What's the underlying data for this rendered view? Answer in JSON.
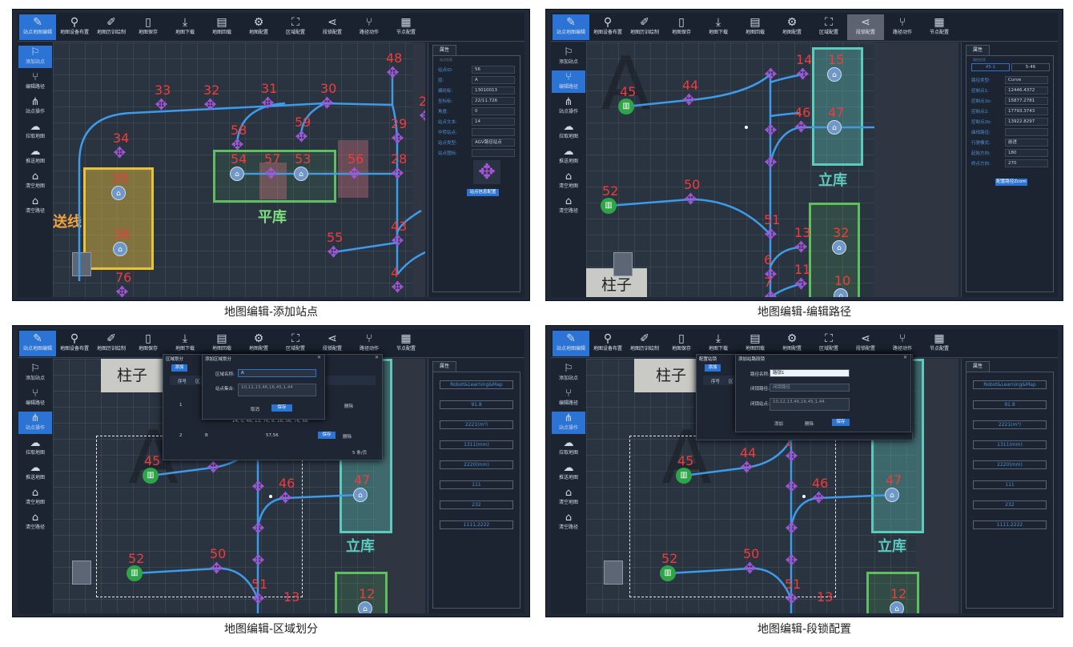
{
  "captions": [
    "地图编辑-添加站点",
    "地图编辑-编辑路径",
    "地图编辑-区域划分",
    "地图编辑-段锁配置"
  ],
  "toolbar": [
    {
      "label": "站点地图编辑",
      "icon": "✎"
    },
    {
      "label": "地图设备布置",
      "icon": "⚲"
    },
    {
      "label": "地图历训绘制",
      "icon": "✐"
    },
    {
      "label": "地图保存",
      "icon": "▯"
    },
    {
      "label": "地图下载",
      "icon": "⤓"
    },
    {
      "label": "地图回载",
      "icon": "▤"
    },
    {
      "label": "地图配置",
      "icon": "⚙"
    },
    {
      "label": "区域配置",
      "icon": "⛶"
    },
    {
      "label": "段锁配置",
      "icon": "⋖"
    },
    {
      "label": "路径动作",
      "icon": "⑂"
    },
    {
      "label": "节点配置",
      "icon": "▦"
    }
  ],
  "sidebar": [
    {
      "label": "添加站点",
      "icon": "⚐"
    },
    {
      "label": "编辑路径",
      "icon": "⑂"
    },
    {
      "label": "站点操作",
      "icon": "⋔"
    },
    {
      "label": "拉取地图",
      "icon": "☁"
    },
    {
      "label": "推送地图",
      "icon": "☁"
    },
    {
      "label": "清空地图",
      "icon": "⌂"
    },
    {
      "label": "清空路径",
      "icon": "⌂"
    }
  ],
  "props_tab": "属性",
  "p1": {
    "section": "站点信息",
    "fields": [
      {
        "label": "站点ID:",
        "value": "56"
      },
      {
        "label": "层:",
        "value": "A"
      },
      {
        "label": "编码标:",
        "value": "13010013"
      },
      {
        "label": "坐标标:",
        "value": "22/11.726"
      },
      {
        "label": "角度:",
        "value": "0"
      },
      {
        "label": "站点文本:",
        "value": "14"
      },
      {
        "label": "中转站点:",
        "value": ""
      },
      {
        "label": "站点类型:",
        "value": "AGV路径站点"
      },
      {
        "label": "站点图标:",
        "value": ""
      }
    ],
    "button": "站点信息配置",
    "labels": [
      "33",
      "32",
      "31",
      "30",
      "48",
      "34",
      "58",
      "59",
      "29",
      "2",
      "57",
      "56",
      "54",
      "53",
      "28",
      "35",
      "36",
      "55",
      "43",
      "76",
      "4"
    ],
    "zone_a": "送线",
    "zone_b": "平库"
  },
  "p2": {
    "section": "路径信息",
    "tab1": "45-1",
    "tab2": "5-46",
    "fields": [
      {
        "label": "路径类型:",
        "value": "Curve"
      },
      {
        "label": "控制点1:",
        "value": "12446.4372"
      },
      {
        "label": "控制点1b:",
        "value": "15877.2781"
      },
      {
        "label": "控制点2:",
        "value": "17793.3743"
      },
      {
        "label": "控制点2b:",
        "value": "13922.8297"
      },
      {
        "label": "曲线路径:",
        "value": ""
      },
      {
        "label": "行驶模式:",
        "value": "前进"
      },
      {
        "label": "起始方向:",
        "value": "180"
      },
      {
        "label": "终点方向:",
        "value": "270"
      }
    ],
    "button": "配置路径Zcom",
    "labels": [
      "45",
      "44",
      "14",
      "15",
      "46",
      "47",
      "52",
      "50",
      "51",
      "13",
      "32",
      "6",
      "11",
      "10",
      "7"
    ],
    "pillar": "柱子",
    "zone": "立库",
    "bigA": "A"
  },
  "p3": {
    "dlg_title": "区域划分",
    "sub_title": "添加区域划分",
    "zone_name_label": "区域名称:",
    "zone_name_value": "A",
    "zone_set_label": "站点集合:",
    "zone_set_value": "10,12,13,46,16,45,1,44",
    "cancel": "取消",
    "save": "保存",
    "tab": "添加",
    "table_head": [
      "序号",
      "区"
    ],
    "rows": [
      {
        "idx": "1",
        "side": "删除"
      },
      {
        "idx": "2",
        "name": "B",
        "set": "57,56",
        "edit": "保存",
        "del": "删除"
      }
    ],
    "row_extra": "14, 0, 48, 13, 76, 8, 28, 06, 76, 68",
    "pager": "5 条/页",
    "props": [
      "Robot&Learning&Map",
      "91.8",
      "2221(m²)",
      "1311(mm)",
      "2220(mm)",
      "111",
      "232",
      "1111,2222"
    ],
    "pillar": "柱子",
    "zone": "立库",
    "bigA": "A",
    "labels": [
      "45",
      "1",
      "46",
      "47",
      "52",
      "50",
      "51",
      "13",
      "12"
    ]
  },
  "p4": {
    "dlg_title": "配置站锁",
    "sub_title": "添加站路段锁",
    "name_label": "路径名称:",
    "name_value": "路锁1",
    "a_label": "闭锁路径:",
    "a_value": "闭锁路径",
    "b_label": "闭锁站点:",
    "b_value": "10,12,13,46,16,45,1,44",
    "add": "添加",
    "del": "删除",
    "save": "保存",
    "tab": "添加",
    "table_head": [
      "序号",
      "区"
    ],
    "props": [
      "Robot&Learning&Map",
      "91.8",
      "2221(m²)",
      "1311(mm)",
      "2220(mm)",
      "111",
      "232",
      "1111,2222"
    ],
    "pillar": "柱子",
    "zone": "立库",
    "bigA": "A",
    "labels": [
      "45",
      "44",
      "1",
      "46",
      "47",
      "52",
      "50",
      "51",
      "13",
      "12"
    ]
  }
}
